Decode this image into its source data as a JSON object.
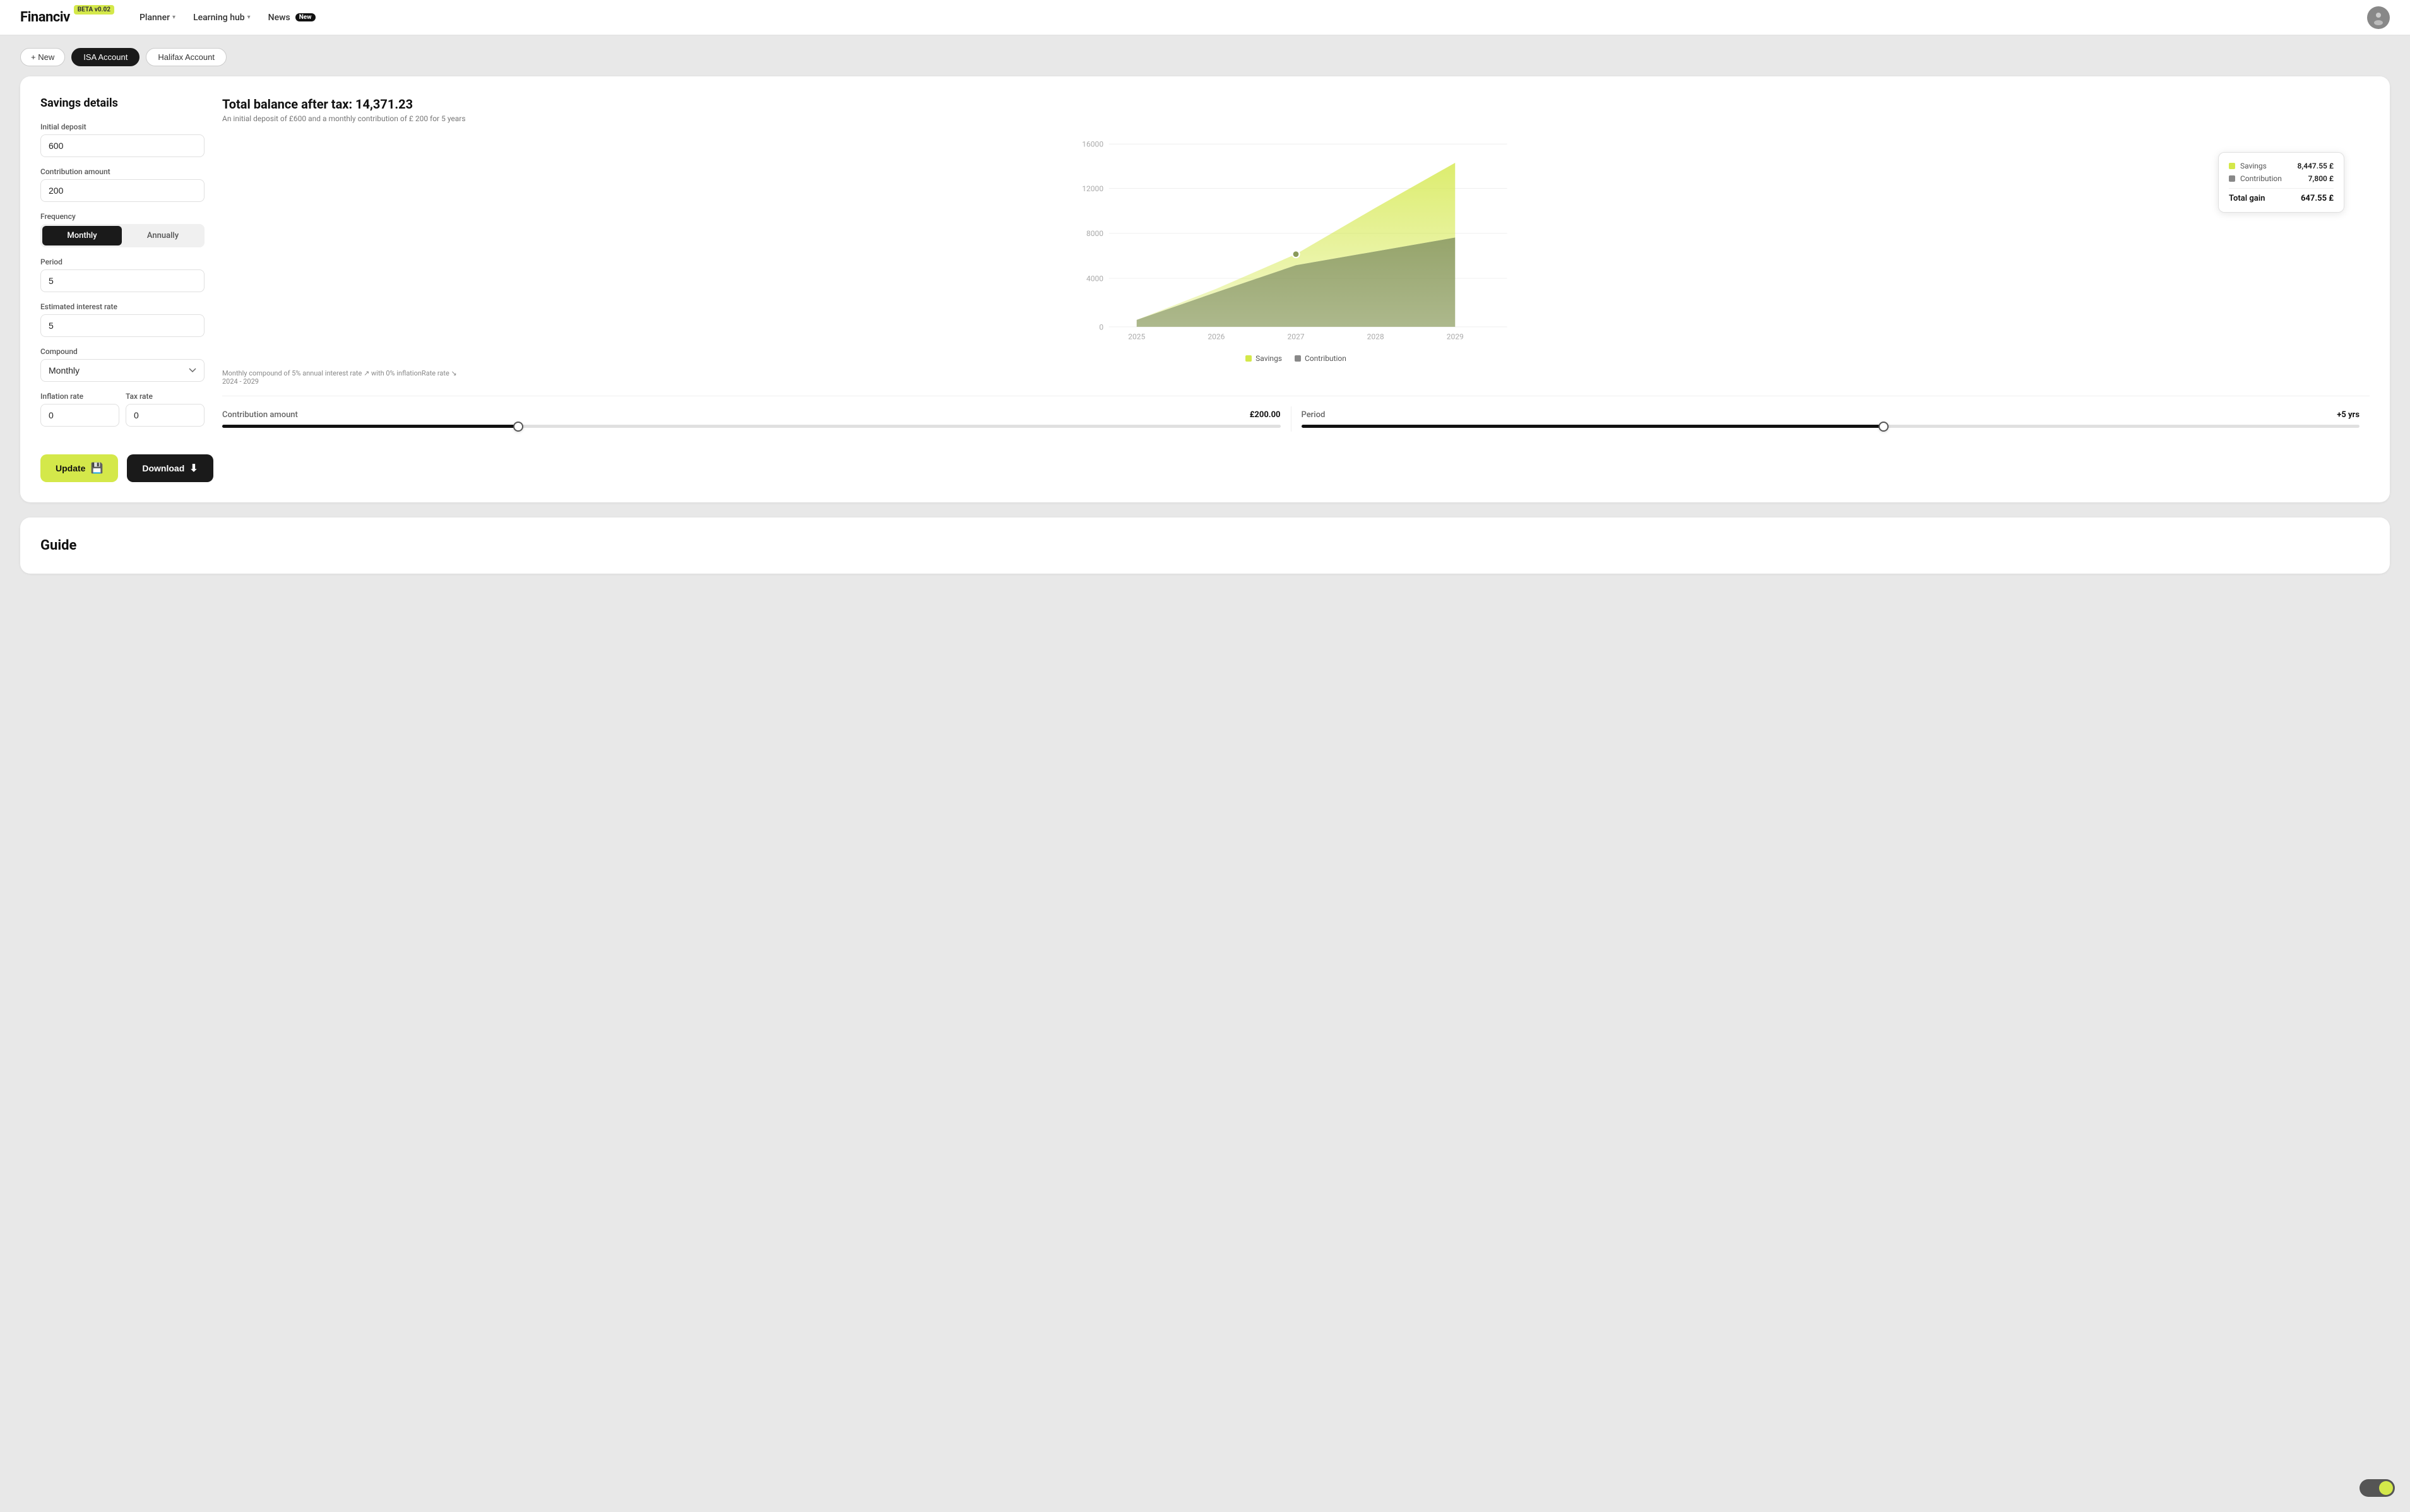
{
  "app": {
    "name": "Financiv",
    "beta": "BETA v0.02"
  },
  "nav": {
    "planner_label": "Planner",
    "learning_hub_label": "Learning hub",
    "news_label": "News",
    "news_badge": "New"
  },
  "tabs": {
    "new_label": "+ New",
    "isa_label": "ISA Account",
    "halifax_label": "Halifax Account"
  },
  "savings_details": {
    "title": "Savings details",
    "initial_deposit_label": "Initial deposit",
    "initial_deposit_value": "600",
    "contribution_amount_label": "Contribution amount",
    "contribution_amount_value": "200",
    "frequency_label": "Frequency",
    "frequency_monthly": "Monthly",
    "frequency_annually": "Annually",
    "period_label": "Period",
    "period_value": "5",
    "estimated_interest_label": "Estimated interest rate",
    "estimated_interest_value": "5",
    "compound_label": "Compound",
    "compound_value": "Monthly",
    "inflation_rate_label": "Inflation rate",
    "inflation_rate_value": "0",
    "tax_rate_label": "Tax rate",
    "tax_rate_value": "0"
  },
  "chart": {
    "title": "Total balance after tax: 14,371.23",
    "subtitle": "An initial deposit of £600 and a monthly contribution of £ 200 for 5 years",
    "tooltip": {
      "savings_label": "Savings",
      "savings_value": "8,447.55 £",
      "contribution_label": "Contribution",
      "contribution_value": "7,800 £",
      "total_gain_label": "Total gain",
      "total_gain_value": "647.55 £"
    },
    "legend": {
      "savings_label": "Savings",
      "contribution_label": "Contribution"
    },
    "y_axis": [
      "16000",
      "12000",
      "8000",
      "4000",
      "0"
    ],
    "x_axis": [
      "2025",
      "2026",
      "2027",
      "2028",
      "2029"
    ],
    "footnote_line1": "Monthly compound of 5% annual interest rate ↗ with 0% inflationRate rate ↘",
    "footnote_line2": "2024 - 2029"
  },
  "sliders": {
    "contribution_label": "Contribution amount",
    "contribution_value": "£200.00",
    "contribution_pct": 28,
    "period_label": "Period",
    "period_value": "+5 yrs",
    "period_pct": 55
  },
  "buttons": {
    "update_label": "Update",
    "download_label": "Download"
  },
  "guide": {
    "title": "Guide"
  },
  "colors": {
    "savings_fill": "#c5cc7a",
    "contribution_fill": "#8a9a5b",
    "savings_dot": "#d4e84a",
    "contribution_dot": "#888",
    "accent": "#d4e84a"
  }
}
